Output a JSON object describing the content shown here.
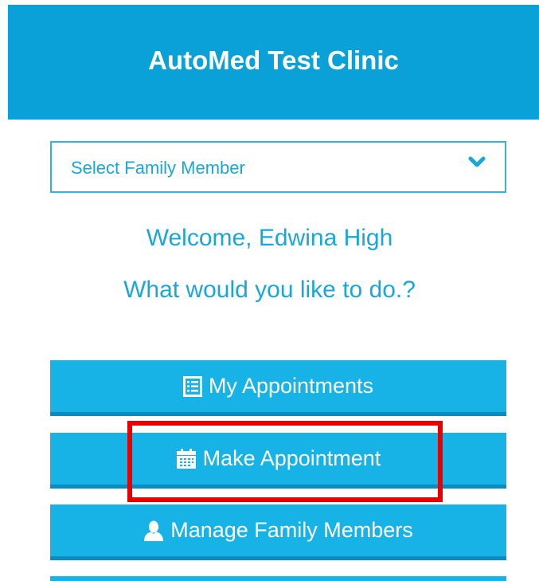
{
  "header": {
    "title": "AutoMed Test Clinic"
  },
  "family_select": {
    "placeholder": "Select Family Member",
    "icon": "chevron-down-icon"
  },
  "welcome": {
    "greeting": "Welcome, Edwina High",
    "prompt": "What would you like to do.?"
  },
  "actions": [
    {
      "label": "My Appointments",
      "icon": "list-icon"
    },
    {
      "label": "Make Appointment",
      "icon": "calendar-icon"
    },
    {
      "label": "Manage Family Members",
      "icon": "user-icon"
    }
  ],
  "colors": {
    "header_bg": "#0aa0d8",
    "accent_text": "#1aa7d6",
    "button_bg": "#17b3e6",
    "button_shadow": "#0b8cc0",
    "highlight": "#e80000"
  }
}
